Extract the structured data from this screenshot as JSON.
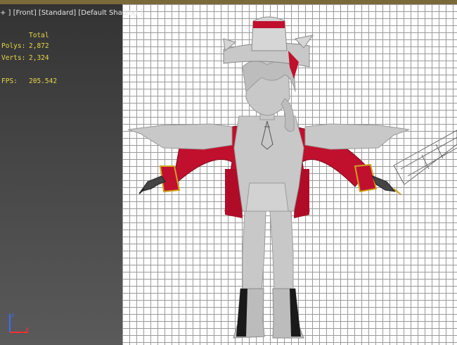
{
  "viewport": {
    "label": "+ ] [Front] [Standard] [Default Shading ]"
  },
  "stats": {
    "header": "Total",
    "polys_label": "Polys:",
    "polys_value": "2,872",
    "verts_label": "Verts:",
    "verts_value": "2,324",
    "fps_label": "FPS:",
    "fps_value": "205.542"
  },
  "colors": {
    "viewport_background": "#ffffff",
    "grid_line": "#9a9a9a",
    "stats_text": "#e8d64a",
    "model_skin": "#c8c8c8",
    "coat_red": "#c0102e",
    "gold_trim": "#d0a020"
  },
  "gizmo": {
    "axes": [
      "z-axis",
      "x-axis"
    ]
  }
}
